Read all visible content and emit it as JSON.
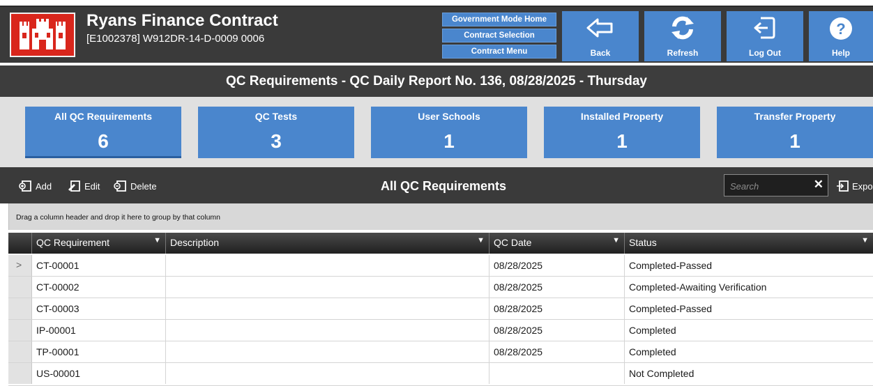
{
  "app": {
    "title": "Ryans Finance Contract",
    "contract_id": "[E1002378] W912DR-14-D-0009  0006"
  },
  "nav_buttons": [
    "Government Mode Home",
    "Contract Selection",
    "Contract Menu"
  ],
  "action_buttons": [
    {
      "label": "Back",
      "icon": "back-arrow-icon"
    },
    {
      "label": "Refresh",
      "icon": "refresh-icon"
    },
    {
      "label": "Log Out",
      "icon": "logout-icon"
    },
    {
      "label": "Help",
      "icon": "help-icon"
    }
  ],
  "page_title": "QC Requirements - QC Daily Report No. 136, 08/28/2025 - Thursday",
  "tiles": [
    {
      "label": "All QC Requirements",
      "count": "6"
    },
    {
      "label": "QC Tests",
      "count": "3"
    },
    {
      "label": "User Schools",
      "count": "1"
    },
    {
      "label": "Installed Property",
      "count": "1"
    },
    {
      "label": "Transfer Property",
      "count": "1"
    }
  ],
  "toolbar": {
    "add": "Add",
    "edit": "Edit",
    "delete": "Delete",
    "title": "All QC Requirements",
    "search_placeholder": "Search",
    "export": "Expo"
  },
  "group_hint": "Drag a column header and drop it here to group by that column",
  "grid": {
    "columns": [
      "QC Requirement",
      "Description",
      "QC Date",
      "Status"
    ],
    "rows": [
      {
        "req": "CT-00001",
        "desc": "",
        "date": "08/28/2025",
        "status": "Completed-Passed"
      },
      {
        "req": "CT-00002",
        "desc": "",
        "date": "08/28/2025",
        "status": "Completed-Awaiting Verification"
      },
      {
        "req": "CT-00003",
        "desc": "",
        "date": "08/28/2025",
        "status": "Completed-Passed"
      },
      {
        "req": "IP-00001",
        "desc": "",
        "date": "08/28/2025",
        "status": "Completed"
      },
      {
        "req": "TP-00001",
        "desc": "",
        "date": "08/28/2025",
        "status": "Completed"
      },
      {
        "req": "US-00001",
        "desc": "",
        "date": "",
        "status": "Not Completed"
      }
    ]
  },
  "colors": {
    "accent": "#4a86cd",
    "header_bg": "#3a3a3a",
    "logo_red": "#d9261c"
  }
}
